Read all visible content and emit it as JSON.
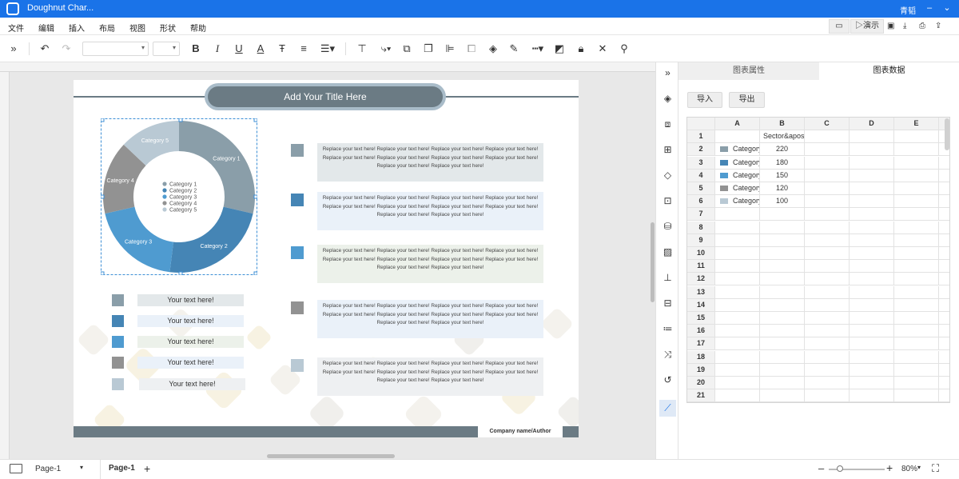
{
  "app": {
    "title": "Doughnut Char...",
    "user": "青韬"
  },
  "menu": [
    "文件",
    "编辑",
    "插入",
    "布局",
    "视图",
    "形状",
    "帮助"
  ],
  "top_actions": {
    "present": "演示"
  },
  "toolbar": {
    "font_select": "",
    "size_select": ""
  },
  "page": {
    "title": "Add Your Title Here",
    "footer": "Company name/Author",
    "legend_boxes": [
      "Your text here!",
      "Your text here!",
      "Your text here!",
      "Your text here!",
      "Your text here!"
    ],
    "text_blocks": [
      "Replace your text here! Replace your text here! Replace your text here! Replace your text here! Replace your text here! Replace your text here! Replace your text here! Replace your text here! Replace your text here! Replace your text here!",
      "Replace your text here! Replace your text here! Replace your text here! Replace your text here! Replace your text here! Replace your text here! Replace your text here! Replace your text here! Replace your text here! Replace your text here!",
      "Replace your text here! Replace your text here! Replace your text here! Replace your text here! Replace your text here! Replace your text here! Replace your text here! Replace your text here! Replace your text here! Replace your text here!",
      "Replace your text here! Replace your text here! Replace your text here! Replace your text here! Replace your text here! Replace your text here! Replace your text here! Replace your text here! Replace your text here! Replace your text here!",
      "Replace your text here! Replace your text here! Replace your text here! Replace your text here! Replace your text here! Replace your text here! Replace your text here! Replace your text here! Replace your text here! Replace your text here!"
    ],
    "text_block_bg": [
      "#e3e8ea",
      "#eaf1f9",
      "#ecf1ea",
      "#eaf1f9",
      "#eef0f2"
    ],
    "legend_box_bg": [
      "#e3e8ea",
      "#eaf1f9",
      "#ecf1ea",
      "#eaf1f9",
      "#eef0f2"
    ]
  },
  "colors": [
    "#8a9ea9",
    "#4585b5",
    "#4f9bd0",
    "#929292",
    "#b9c9d4"
  ],
  "chart_data": {
    "type": "doughnut",
    "categories": [
      "Category 1",
      "Category 2",
      "Category 3",
      "Category 4",
      "Category 5"
    ],
    "values": [
      220,
      180,
      150,
      120,
      100
    ],
    "legend": "center"
  },
  "panel": {
    "tabs": [
      "图表属性",
      "图表数据"
    ],
    "import_label": "导入",
    "export_label": "导出",
    "columns": [
      "A",
      "B",
      "C",
      "D",
      "E"
    ],
    "header_cell_b1": "Sector&apos;",
    "rows": [
      {
        "num": "1",
        "name": "",
        "value": ""
      },
      {
        "num": "2",
        "name": "Category 1",
        "value": "220"
      },
      {
        "num": "3",
        "name": "Category 2",
        "value": "180"
      },
      {
        "num": "4",
        "name": "Category 3",
        "value": "150"
      },
      {
        "num": "5",
        "name": "Category 4",
        "value": "120"
      },
      {
        "num": "6",
        "name": "Category 5",
        "value": "100"
      }
    ],
    "empty_rows": [
      "7",
      "8",
      "9",
      "10",
      "11",
      "12",
      "13",
      "14",
      "15",
      "16",
      "17",
      "18",
      "19",
      "20",
      "21"
    ]
  },
  "status": {
    "page_select": "Page-1",
    "page_tab": "Page-1",
    "zoom": "80%"
  }
}
